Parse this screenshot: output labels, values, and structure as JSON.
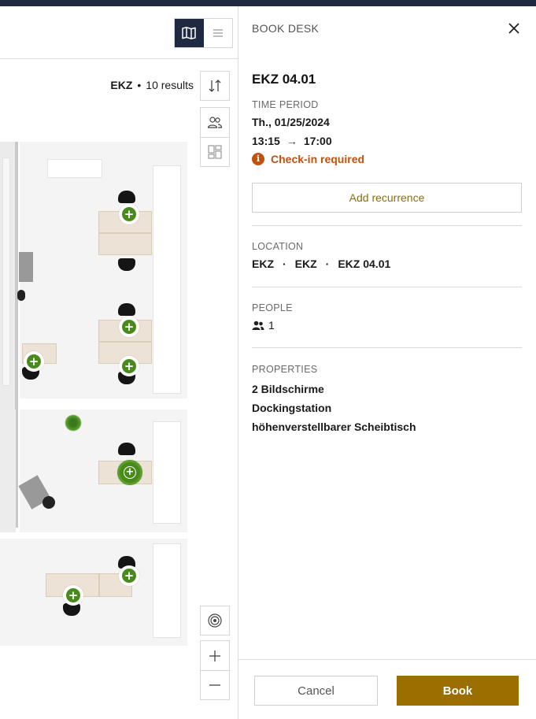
{
  "map": {
    "results_location": "EKZ",
    "results_count": "10 results",
    "results_separator": "•",
    "view_toggle": {
      "active": "map",
      "icons": [
        "map-icon",
        "list-icon"
      ]
    },
    "tools": [
      "sort-icon",
      "people-filter-icon",
      "layout-icon",
      "locate-icon",
      "zoom-in-icon",
      "zoom-out-icon"
    ]
  },
  "panel": {
    "header": "BOOK DESK",
    "desk_name": "EKZ 04.01",
    "time_period_label": "TIME PERIOD",
    "date": "Th., 01/25/2024",
    "time_start": "13:15",
    "time_arrow": "→",
    "time_end": "17:00",
    "checkin": "Check-in required",
    "add_recurrence": "Add recurrence",
    "location_label": "LOCATION",
    "location_parts": [
      "EKZ",
      "EKZ",
      "EKZ 04.01"
    ],
    "location_separator": "·",
    "people_label": "PEOPLE",
    "people_count": "1",
    "properties_label": "PROPERTIES",
    "properties": [
      "2 Bildschirme",
      "Dockingstation",
      "höhenverstellbarer Scheibtisch"
    ],
    "cancel": "Cancel",
    "book": "Book"
  },
  "colors": {
    "navy": "#1f2942",
    "accent_gold": "#9a6f00",
    "gold_text": "#8a6d13",
    "warning_orange": "#c0510f",
    "marker_green": "#4a8a1c"
  }
}
